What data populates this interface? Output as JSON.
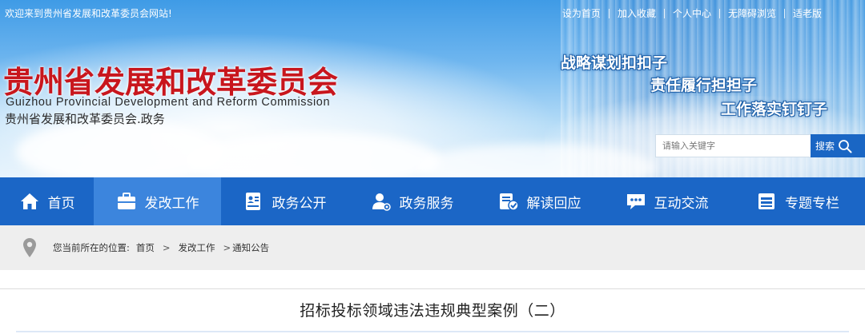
{
  "header": {
    "welcome": "欢迎来到贵州省发展和改革委员会网站!",
    "top_links": [
      "设为首页",
      "加入收藏",
      "个人中心",
      "无障碍浏览",
      "适老版"
    ],
    "site_title": "贵州省发展和改革委员会",
    "site_title_en": "Guizhou Provincial Development and Reform Commission",
    "site_subtitle": "贵州省发展和改革委员会.政务",
    "slogans": [
      "战略谋划扣扣子",
      "责任履行担担子",
      "工作落实钉钉子"
    ],
    "search": {
      "placeholder": "请输入关键字",
      "button_label": "搜索"
    }
  },
  "nav": {
    "items": [
      {
        "label": "首页",
        "icon": "home-icon"
      },
      {
        "label": "发改工作",
        "icon": "briefcase-icon",
        "active": true
      },
      {
        "label": "政务公开",
        "icon": "id-card-icon"
      },
      {
        "label": "政务服务",
        "icon": "user-service-icon"
      },
      {
        "label": "解读回应",
        "icon": "document-check-icon"
      },
      {
        "label": "互动交流",
        "icon": "chat-bubble-icon"
      },
      {
        "label": "专题专栏",
        "icon": "window-icon"
      }
    ]
  },
  "breadcrumb": {
    "prefix": "您当前所在的位置:",
    "items": [
      "首页",
      "发改工作",
      "通知公告"
    ],
    "separator": ">"
  },
  "article": {
    "title": "招标投标领域违法违规典型案例（二）"
  },
  "colors": {
    "nav_bg": "#1b66c6",
    "nav_active": "#3c85dd",
    "title_red": "#c8161d",
    "breadcrumb_bg": "#eeeeee"
  }
}
